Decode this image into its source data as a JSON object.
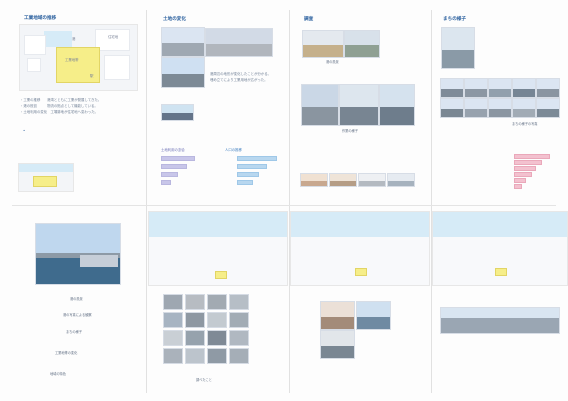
{
  "page": {
    "top_left": {
      "title": "工業地域の推移"
    },
    "panel1": {
      "labels": [
        "港",
        "工業地帯",
        "駅",
        "住宅地"
      ],
      "text": [
        "・工業の推移　　港湾とともに工業が発展してきた。",
        "・港の役割　　　物流の拠点として機能している。",
        "・土地利用の変化　工場跡地が住宅地へ変わった。"
      ]
    },
    "panel2": {
      "title": "土地の変化",
      "text": [
        "港周辺の地形が変化したことが分かる。",
        "埋め立てにより工業用地が広がった。"
      ]
    },
    "panel3": {
      "title": "調査",
      "captions": [
        "港の風景",
        "作業の様子"
      ]
    },
    "panel4": {
      "title": "まちの様子",
      "caption": "まちの様子の写真"
    },
    "bottom": {
      "captions": [
        "港の風景",
        "港の写真による観察",
        "まちの様子",
        "工業地帯の変化",
        "地域の特色",
        "調べたこと"
      ]
    },
    "chart_left": {
      "title": "土地利用の割合",
      "series": [
        {
          "values": [
            60,
            45,
            28,
            18
          ]
        },
        {
          "values": [
            22,
            38,
            50,
            68
          ]
        }
      ]
    },
    "chart_right": {
      "title": "人口の推移",
      "series": [
        {
          "values": [
            70,
            52,
            40,
            35,
            25,
            15
          ]
        }
      ]
    }
  }
}
